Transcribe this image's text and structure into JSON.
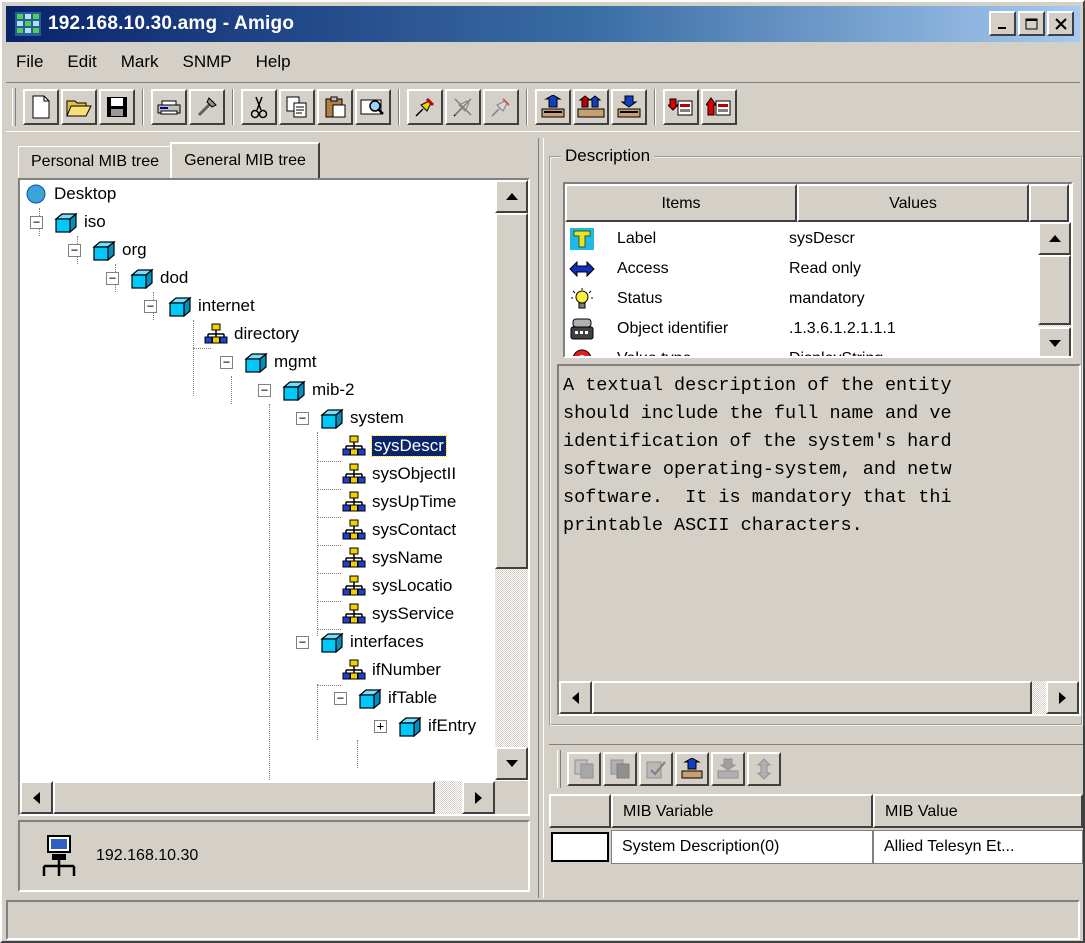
{
  "window": {
    "title": "192.168.10.30.amg - Amigo",
    "min_btn": "_",
    "max_btn": "□",
    "close_btn": "×"
  },
  "menu": [
    "File",
    "Edit",
    "Mark",
    "SNMP",
    "Help"
  ],
  "toolbar": {
    "buttons": [
      "new-icon",
      "open-icon",
      "save-icon",
      "print-icon",
      "properties-icon",
      "cut-icon",
      "copy-icon",
      "paste-icon",
      "find-icon",
      "pin-icon",
      "unpin-icon",
      "unpin-all-icon",
      "get-icon",
      "get-next-icon",
      "set-icon",
      "walk-icon",
      "trap-icon"
    ]
  },
  "tabs": [
    "Personal MIB tree",
    "General MIB tree"
  ],
  "tree": {
    "nodes": [
      {
        "label": "Desktop",
        "icon": "globe-icon"
      },
      {
        "label": "iso",
        "icon": "folder-cube-icon"
      },
      {
        "label": "org",
        "icon": "folder-cube-icon"
      },
      {
        "label": "dod",
        "icon": "folder-cube-icon"
      },
      {
        "label": "internet",
        "icon": "folder-cube-icon"
      },
      {
        "label": "directory",
        "icon": "leaf-network-icon"
      },
      {
        "label": "mgmt",
        "icon": "folder-cube-icon"
      },
      {
        "label": "mib-2",
        "icon": "folder-cube-icon"
      },
      {
        "label": "system",
        "icon": "folder-cube-icon"
      },
      {
        "label": "sysDescr",
        "icon": "leaf-network-icon"
      },
      {
        "label": "sysObjectII",
        "icon": "leaf-network-icon"
      },
      {
        "label": "sysUpTime",
        "icon": "leaf-network-icon"
      },
      {
        "label": "sysContact",
        "icon": "leaf-network-icon"
      },
      {
        "label": "sysName",
        "icon": "leaf-network-icon"
      },
      {
        "label": "sysLocatio",
        "icon": "leaf-network-icon"
      },
      {
        "label": "sysService",
        "icon": "leaf-network-icon"
      },
      {
        "label": "interfaces",
        "icon": "folder-cube-icon"
      },
      {
        "label": "ifNumber",
        "icon": "leaf-network-icon"
      },
      {
        "label": "ifTable",
        "icon": "folder-cube-icon"
      },
      {
        "label": "ifEntry",
        "icon": "folder-cube-icon"
      }
    ],
    "selected": "sysDescr"
  },
  "host": {
    "address": "192.168.10.30",
    "icon": "network-host-icon"
  },
  "description": {
    "group_title": "Description",
    "columns": [
      "Items",
      "Values"
    ],
    "rows": [
      {
        "item": "Label",
        "value": "sysDescr",
        "icon": "label-icon"
      },
      {
        "item": "Access",
        "value": "Read only",
        "icon": "access-icon"
      },
      {
        "item": "Status",
        "value": "mandatory",
        "icon": "status-bulb-icon"
      },
      {
        "item": "Object identifier",
        "value": ".1.3.6.1.2.1.1.1",
        "icon": "object-id-icon"
      },
      {
        "item": "Value type",
        "value": "DisplayString",
        "icon": "value-type-icon"
      }
    ],
    "text": "A textual description of the entity\nshould include the full name and ve\nidentification of the system's hard\nsoftware operating-system, and netw\nsoftware.  It is mandatory that thi\nprintable ASCII characters."
  },
  "mib_toolbar": [
    "copy-var-icon",
    "paste-var-icon",
    "check-var-icon",
    "get-var-icon",
    "set-var-icon",
    "move-var-icon"
  ],
  "mib_table": {
    "columns": [
      "MIB Variable",
      "MIB Value"
    ],
    "rows": [
      {
        "variable": "System Description(0)",
        "value": "Allied Telesyn Et..."
      }
    ]
  },
  "colors": {
    "title_gradient_start": "#0a246a",
    "title_gradient_end": "#a6caf0",
    "selection": "#0a246a",
    "face": "#d4d0c8"
  }
}
